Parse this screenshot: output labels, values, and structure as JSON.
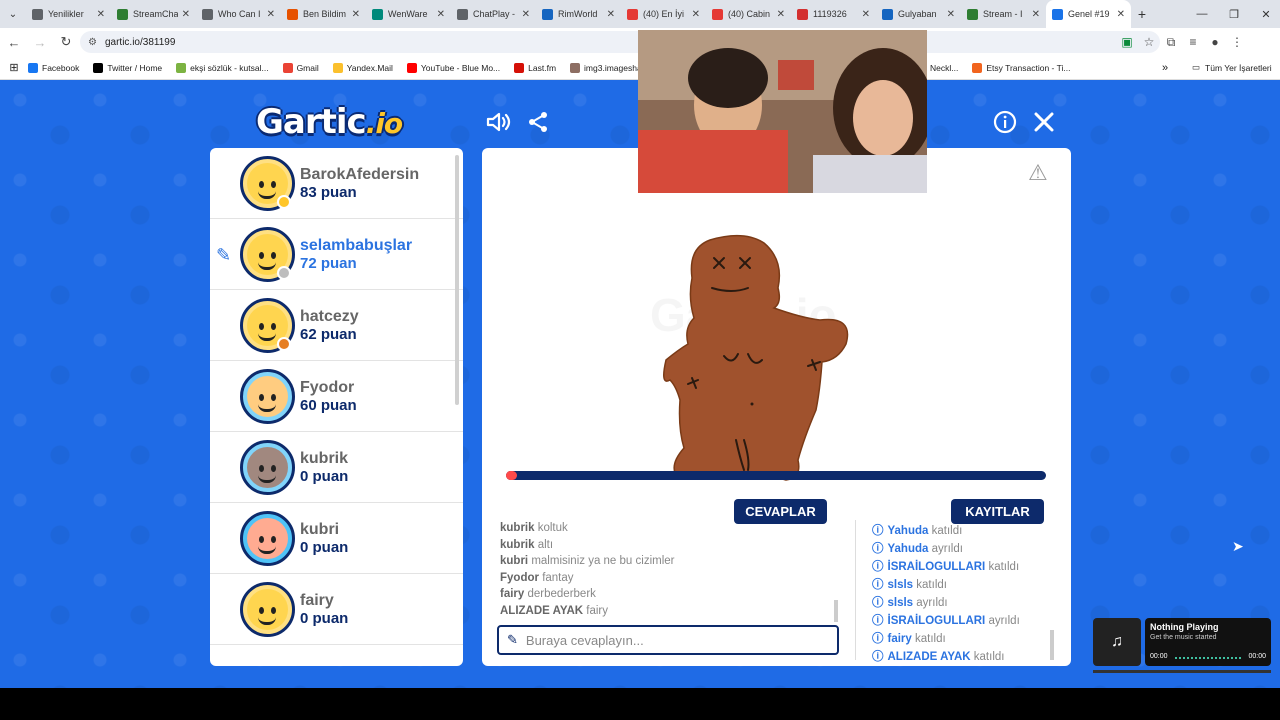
{
  "browser": {
    "tabs": [
      {
        "title": "Yenilikler",
        "color": "#5f6368"
      },
      {
        "title": "StreamCha",
        "color": "#2e7d32"
      },
      {
        "title": "Who Can I",
        "color": "#5f6368"
      },
      {
        "title": "Ben Bildim",
        "color": "#e65100"
      },
      {
        "title": "WenWare",
        "color": "#00897b"
      },
      {
        "title": "ChatPlay -",
        "color": "#5f6368"
      },
      {
        "title": "RimWorld",
        "color": "#1565c0"
      },
      {
        "title": "(40) En İyi",
        "color": "#e53935"
      },
      {
        "title": "(40) Cabin",
        "color": "#e53935"
      },
      {
        "title": "1119326",
        "color": "#d32f2f"
      },
      {
        "title": "Gulyaban",
        "color": "#1565c0"
      },
      {
        "title": "Stream - I",
        "color": "#2e7d32"
      },
      {
        "title": "Genel #19",
        "color": "#1a73e8",
        "active": true
      }
    ],
    "url": "gartic.io/381199",
    "bookmarks": [
      {
        "label": "Facebook",
        "color": "#1877f2"
      },
      {
        "label": "Twitter / Home",
        "color": "#000000"
      },
      {
        "label": "ekşi sözlük - kutsal...",
        "color": "#7cb342"
      },
      {
        "label": "Gmail",
        "color": "#ea4335"
      },
      {
        "label": "Yandex.Mail",
        "color": "#fbc02d"
      },
      {
        "label": "YouTube - Blue Mo...",
        "color": "#ff0000"
      },
      {
        "label": "Last.fm",
        "color": "#d51007"
      },
      {
        "label": "img3.imageshack.us...",
        "color": "#8d6e63"
      }
    ],
    "bookmarks_right": [
      {
        "label": "Neckl..."
      },
      {
        "label": "Etsy Transaction - Ti...",
        "color": "#f1641e"
      }
    ],
    "all_bookmarks": "Tüm Yer İşaretleri"
  },
  "game": {
    "logo_main": "Gartic",
    "logo_suffix": ".io",
    "players": [
      {
        "name": "BarokAfedersin",
        "score": "83 puan",
        "face": "#ffd54f",
        "bg": "#ffe082",
        "dot": "#ffc629"
      },
      {
        "name": "selambabuşlar",
        "score": "72 puan",
        "face": "#ffd54f",
        "bg": "#ffe082",
        "dot": "#bdbdbd",
        "drawing": true
      },
      {
        "name": "hatcezy",
        "score": "62 puan",
        "face": "#ffd54f",
        "bg": "#ffe082",
        "dot": "#e67e22"
      },
      {
        "name": "Fyodor",
        "score": "60 puan",
        "face": "#ffcc80",
        "bg": "#81d4fa"
      },
      {
        "name": "kubrik",
        "score": "0 puan",
        "face": "#a1887f",
        "bg": "#81d4fa"
      },
      {
        "name": "kubri",
        "score": "0 puan",
        "face": "#ffab91",
        "bg": "#4fc3f7"
      },
      {
        "name": "fairy",
        "score": "0 puan",
        "face": "#ffd54f",
        "bg": "#ffe082"
      }
    ],
    "timer_fraction": 0.02,
    "tab_answers": "CEVAPLAR",
    "tab_logs": "KAYITLAR",
    "answers": [
      {
        "user": "kubrik",
        "text": "koltuk"
      },
      {
        "user": "kubrik",
        "text": "altı"
      },
      {
        "user": "kubri",
        "text": "malmisiniz ya ne bu cizimler"
      },
      {
        "user": "Fyodor",
        "text": "fantay"
      },
      {
        "user": "fairy",
        "text": "derbederberk"
      },
      {
        "user": "ALIZADE AYAK",
        "text": "fairy"
      }
    ],
    "answer_placeholder": "Buraya cevaplayın...",
    "logs": [
      {
        "user": "Yahuda",
        "action": "katıldı"
      },
      {
        "user": "Yahuda",
        "action": "ayrıldı"
      },
      {
        "user": "İSRAİLOGULLARI",
        "action": "katıldı"
      },
      {
        "user": "slsls",
        "action": "katıldı"
      },
      {
        "user": "slsls",
        "action": "ayrıldı"
      },
      {
        "user": "İSRAİLOGULLARI",
        "action": "ayrıldı"
      },
      {
        "user": "fairy",
        "action": "katıldı"
      },
      {
        "user": "ALIZADE AYAK",
        "action": "katıldı"
      }
    ]
  },
  "music": {
    "title": "Nothing Playing",
    "subtitle": "Get the music started",
    "time_start": "00:00",
    "time_end": "00:00"
  }
}
